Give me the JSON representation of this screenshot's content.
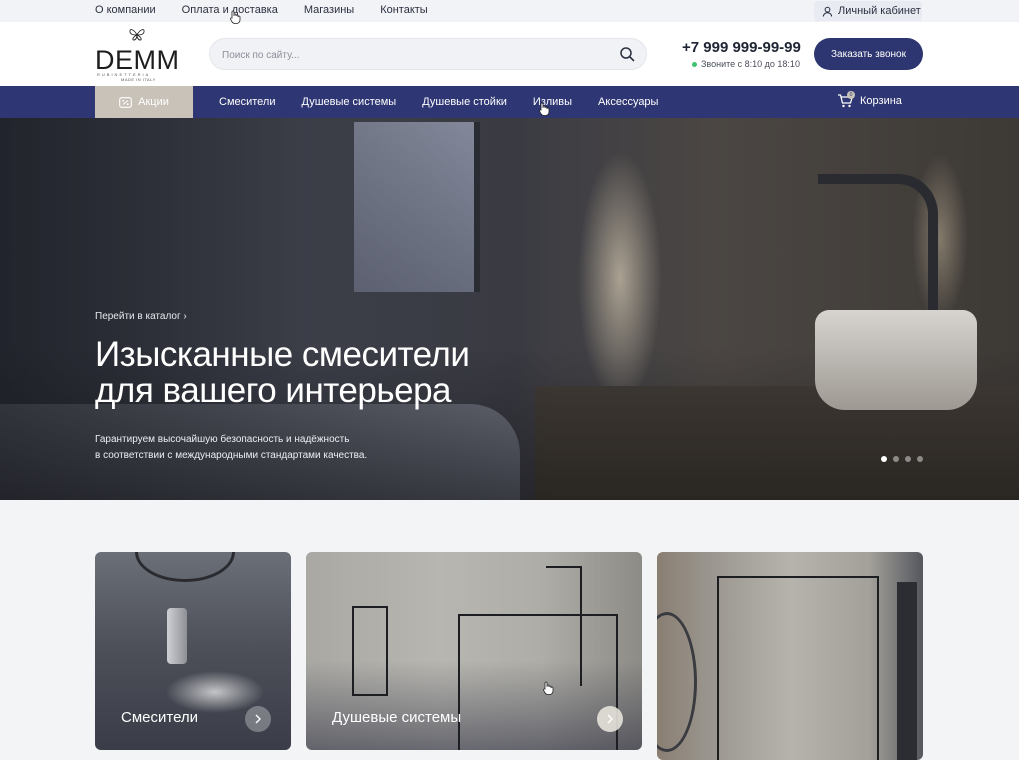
{
  "topbar": {
    "links": [
      "О компании",
      "Оплата и доставка",
      "Магазины",
      "Контакты"
    ],
    "cabinet": "Личный кабинет"
  },
  "header": {
    "logo": {
      "word": "DEMM",
      "sub1": "RUBINETTERIA",
      "sub2": "MADE IN ITALY"
    },
    "search_placeholder": "Поиск по сайту...",
    "phone": "+7 999 999-99-99",
    "hours": "Звоните с 8:10 до 18:10",
    "call_button": "Заказать звонок"
  },
  "nav": {
    "promo": "Акции",
    "items": [
      "Смесители",
      "Душевые системы",
      "Душевые стойки",
      "Изливы",
      "Аксессуары"
    ],
    "cart": "Корзина",
    "cart_count": "0"
  },
  "hero": {
    "catalog_link": "Перейти в каталог",
    "title_line1": "Изысканные смесители",
    "title_line2": "для вашего интерьера",
    "desc_line1": "Гарантируем высочайшую безопасность и надёжность",
    "desc_line2": "в соответствии с международными стандартами качества.",
    "slides": 4,
    "active_slide": 1
  },
  "cards": [
    {
      "label": "Смесители"
    },
    {
      "label": "Душевые системы"
    },
    {
      "label": ""
    }
  ],
  "colors": {
    "primary": "#2e3673",
    "promo": "#c8c2b8",
    "accent_dot": "#3ec46d"
  }
}
